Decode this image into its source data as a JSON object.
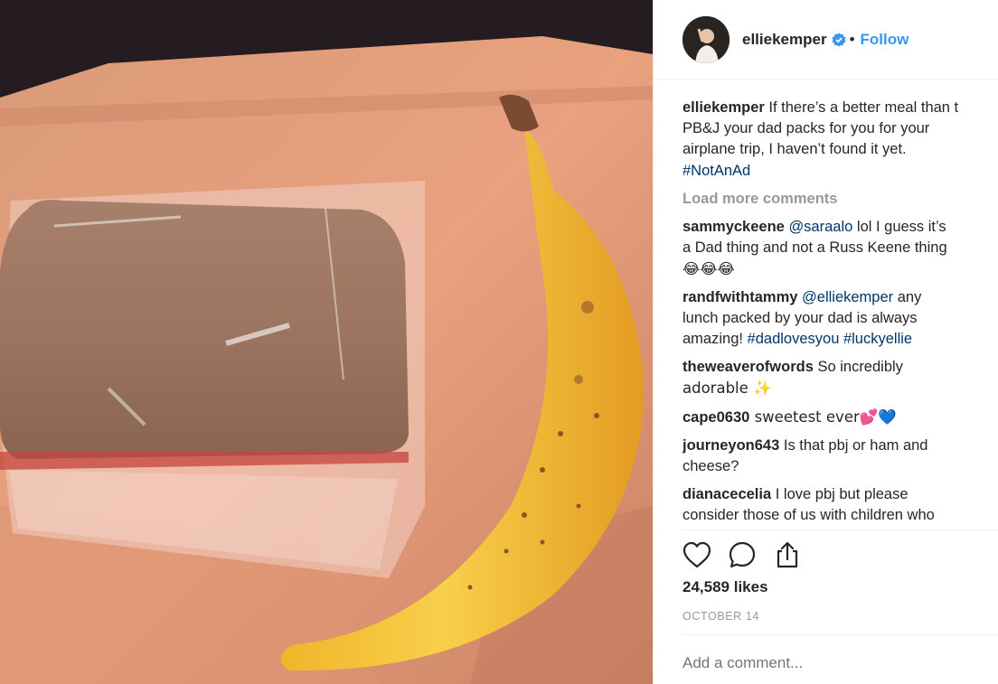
{
  "post": {
    "username": "elliekemper",
    "follow_label": "Follow",
    "separator": "•",
    "caption": {
      "username": "elliekemper",
      "lines": [
        "If there’s a better meal than t",
        "PB&J your dad packs for you for your",
        "airplane trip, I haven’t found it yet."
      ],
      "hashtag": "#NotAnAd"
    },
    "load_more_label": "Load more comments",
    "comments": [
      {
        "username": "sammyckeene",
        "mention": "@saraalo",
        "line1": " lol I guess it’s",
        "line2": "a Dad thing and not a Russ Keene thing",
        "line3": "😂😂😂"
      },
      {
        "username": "randfwithtammy",
        "mention": "@elliekemper",
        "line1": " any",
        "line2": "lunch packed by your dad is always",
        "line3_text": "amazing! ",
        "tag1": "#dadlovesyou",
        "tag2": "#luckyellie"
      },
      {
        "username": "theweaverofwords",
        "line1": " So incredibly",
        "line2": "adorable ✨"
      },
      {
        "username": "cape0630",
        "line1": " sweetest ever💕💙"
      },
      {
        "username": "journeyon643",
        "line1": " Is that pbj or ham and",
        "line2": "cheese?"
      },
      {
        "username": "dianacecelia",
        "line1": " I love pbj but please",
        "line2": "consider those of us with children who"
      }
    ],
    "likes": "24,589 likes",
    "date": "OCTOBER 14",
    "add_comment_placeholder": "Add a comment..."
  },
  "icons": {
    "verified": "verified-badge-icon",
    "like": "heart-icon",
    "comment": "speech-bubble-icon",
    "share": "share-icon"
  },
  "colors": {
    "link_blue": "#3897f0",
    "hashtag": "#003569",
    "muted": "#999999",
    "text": "#262626"
  }
}
